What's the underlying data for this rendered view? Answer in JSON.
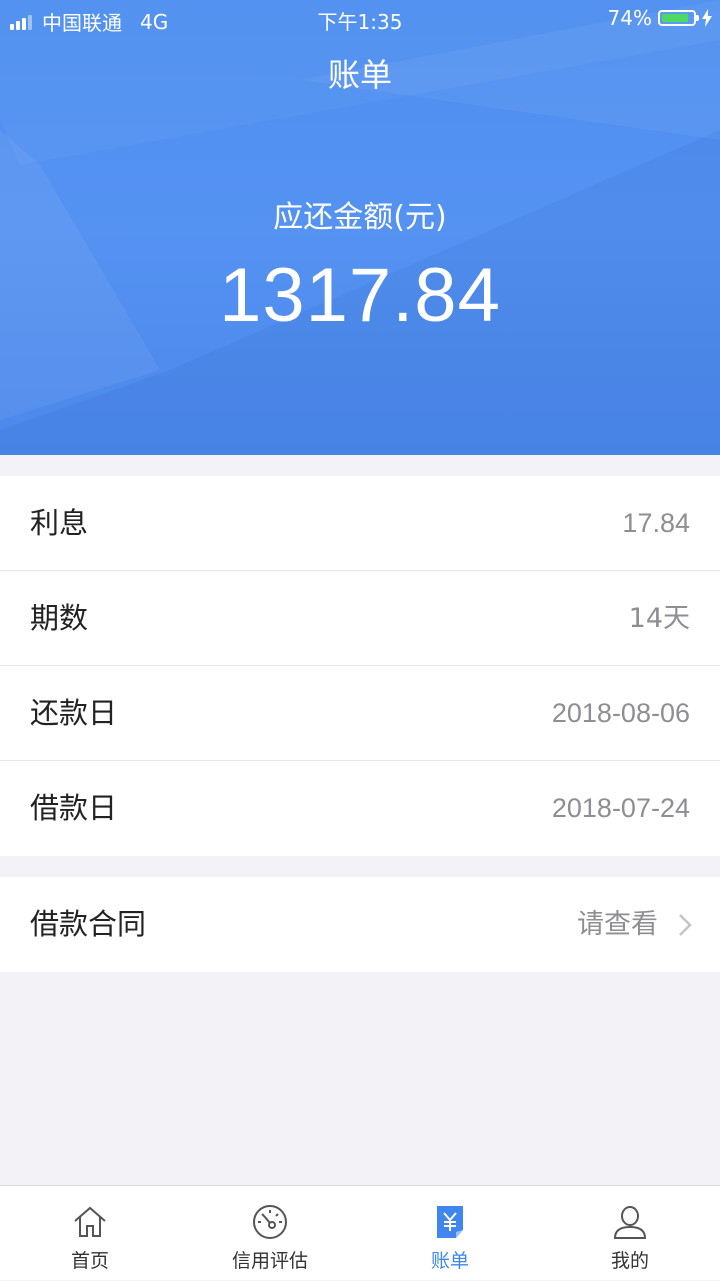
{
  "status_bar": {
    "carrier": "中国联通",
    "network": "4G",
    "time": "下午1:35",
    "battery": "74%",
    "battery_level": 0.74
  },
  "header": {
    "title": "账单",
    "amount_label": "应还金额(元)",
    "amount_value": "1317.84"
  },
  "details": [
    {
      "label": "利息",
      "value": "17.84"
    },
    {
      "label": "期数",
      "value": "14天"
    },
    {
      "label": "还款日",
      "value": "2018-08-06"
    },
    {
      "label": "借款日",
      "value": "2018-07-24"
    }
  ],
  "contract": {
    "label": "借款合同",
    "value": "请查看"
  },
  "tabs": [
    {
      "label": "首页",
      "icon": "home-icon"
    },
    {
      "label": "信用评估",
      "icon": "gauge-icon"
    },
    {
      "label": "账单",
      "icon": "bill-icon"
    },
    {
      "label": "我的",
      "icon": "user-icon"
    }
  ],
  "colors": {
    "primary": "#4d8ef0",
    "active_tab": "#3f86ee",
    "battery": "#4cd964"
  }
}
